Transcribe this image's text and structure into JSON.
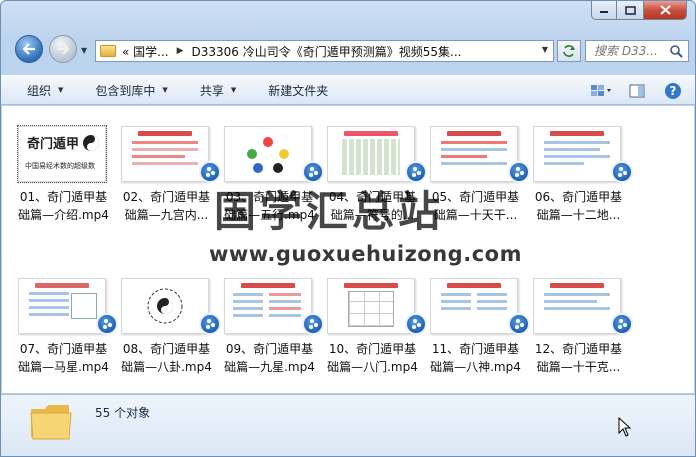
{
  "address": {
    "crumbs": [
      "«  国学...",
      "D33306 冷山司令《奇门遁甲预测篇》视频55集..."
    ]
  },
  "search": {
    "placeholder": "搜索 D33..."
  },
  "toolbar": {
    "organize": "组织",
    "include_library": "包含到库中",
    "share": "共享",
    "new_folder": "新建文件夹"
  },
  "files": [
    {
      "line1": "01、奇门遁甲基",
      "line2": "础篇—介绍.mp4"
    },
    {
      "line1": "02、奇门遁甲基",
      "line2": "础篇—九宫内..."
    },
    {
      "line1": "03、奇门遁甲基",
      "line2": "础篇—五行.mp4"
    },
    {
      "line1": "04、奇门遁甲基",
      "line2": "础篇—符号的..."
    },
    {
      "line1": "05、奇门遁甲基",
      "line2": "础篇—十天干..."
    },
    {
      "line1": "06、奇门遁甲基",
      "line2": "础篇—十二地..."
    },
    {
      "line1": "07、奇门遁甲基",
      "line2": "础篇—马星.mp4"
    },
    {
      "line1": "08、奇门遁甲基",
      "line2": "础篇—八卦.mp4"
    },
    {
      "line1": "09、奇门遁甲基",
      "line2": "础篇—九星.mp4"
    },
    {
      "line1": "10、奇门遁甲基",
      "line2": "础篇—八门.mp4"
    },
    {
      "line1": "11、奇门遁甲基",
      "line2": "础篇—八神.mp4"
    },
    {
      "line1": "12、奇门遁甲基",
      "line2": "础篇—十干克..."
    }
  ],
  "cover": {
    "title": "奇门遁甲",
    "subtitle": "中国易经术数的超级数"
  },
  "watermark": {
    "cn": "国学汇总站",
    "url": "www.guoxuehuizong.com"
  },
  "status": {
    "count": "55 个对象"
  },
  "colors": {
    "accent": "#2f6fb8",
    "play_badge": "#1f5fb3",
    "window_frame": "#b7cfea"
  }
}
